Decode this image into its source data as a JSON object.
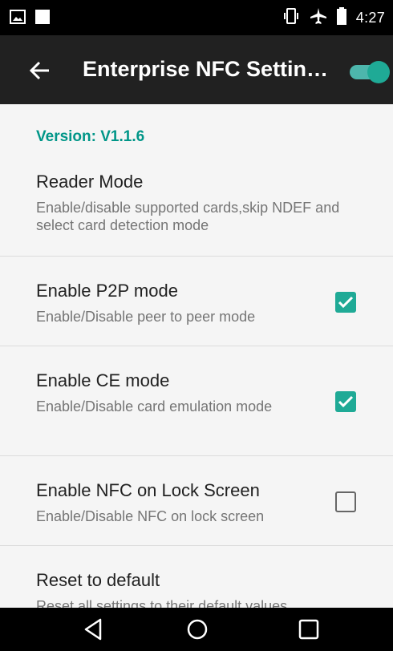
{
  "status_bar": {
    "time": "4:27",
    "icons_left": [
      "image-icon",
      "square-icon"
    ],
    "icons_right": [
      "vibrate-icon",
      "airplane-icon",
      "battery-icon"
    ]
  },
  "app_bar": {
    "title": "Enterprise NFC Settin…",
    "nfc_toggle_on": true,
    "accent": "#1faa96"
  },
  "settings": {
    "version": "Version: V1.1.6",
    "reader_mode": {
      "title": "Reader Mode",
      "summary": "Enable/disable supported cards,skip NDEF and select card detection mode"
    },
    "p2p": {
      "title": "Enable P2P mode",
      "summary": "Enable/Disable peer to peer mode",
      "checked": true
    },
    "ce": {
      "title": "Enable CE mode",
      "summary": "Enable/Disable card emulation mode",
      "checked": true
    },
    "lock_screen": {
      "title": "Enable NFC on Lock Screen",
      "summary": "Enable/Disable NFC on lock screen",
      "checked": false
    },
    "reset": {
      "title": "Reset to default",
      "summary": "Reset all settings to their default values"
    }
  },
  "nav_bar": {
    "buttons": [
      "back-icon",
      "home-icon",
      "recents-icon"
    ]
  }
}
